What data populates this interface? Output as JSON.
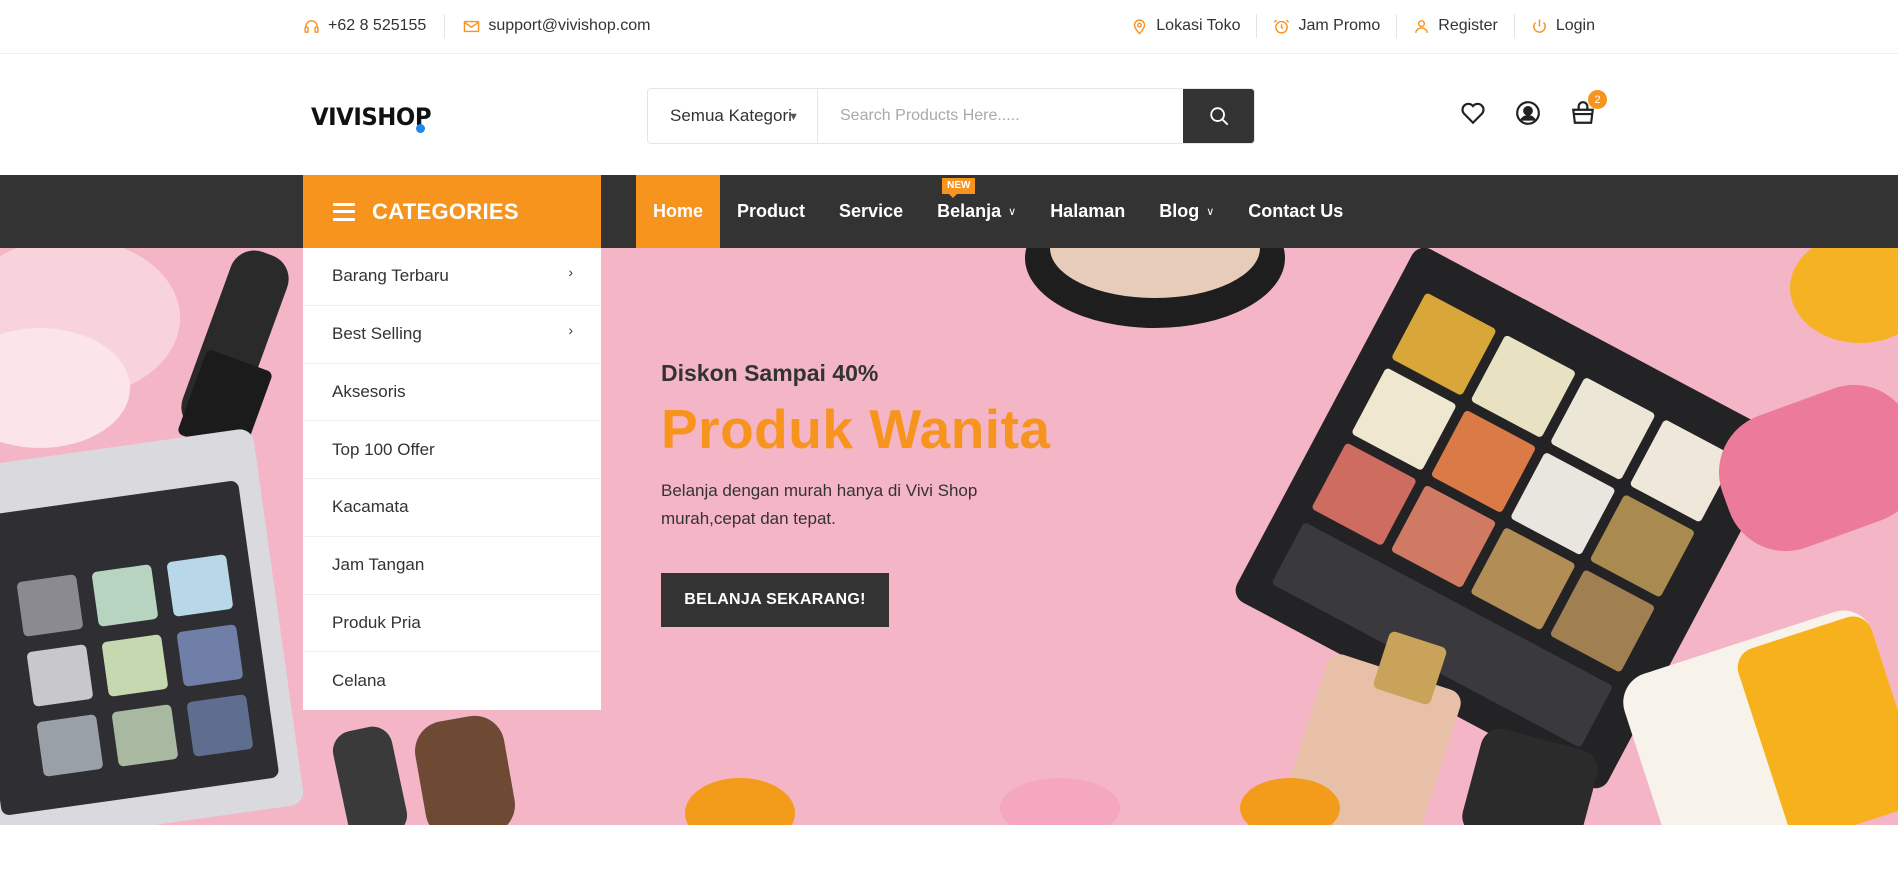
{
  "topbar": {
    "phone": "+62 8 525155",
    "email": "support@vivishop.com",
    "location": "Lokasi Toko",
    "promo": "Jam Promo",
    "register": "Register",
    "login": "Login"
  },
  "header": {
    "logo": "VIVISHOP",
    "search_category": "Semua Kategori",
    "search_placeholder": "Search Products Here.....",
    "cart_count": "2"
  },
  "nav": {
    "categories_label": "CATEGORIES",
    "items": [
      {
        "label": "Home"
      },
      {
        "label": "Product"
      },
      {
        "label": "Service"
      },
      {
        "label": "Belanja",
        "badge": "NEW"
      },
      {
        "label": "Halaman"
      },
      {
        "label": "Blog"
      },
      {
        "label": "Contact Us"
      }
    ]
  },
  "categories": [
    "Barang Terbaru",
    "Best Selling",
    "Aksesoris",
    "Top 100 Offer",
    "Kacamata",
    "Jam Tangan",
    "Produk Pria",
    "Celana"
  ],
  "hero": {
    "subtitle": "Diskon Sampai 40%",
    "title": "Produk Wanita",
    "desc_line1": "Belanja dengan murah hanya di Vivi Shop",
    "desc_line2": "murah,cepat dan tepat.",
    "button": "BELANJA SEKARANG!"
  },
  "colors": {
    "accent": "#f7941d",
    "dark": "#333333",
    "hero_bg": "#f4b5c7"
  }
}
